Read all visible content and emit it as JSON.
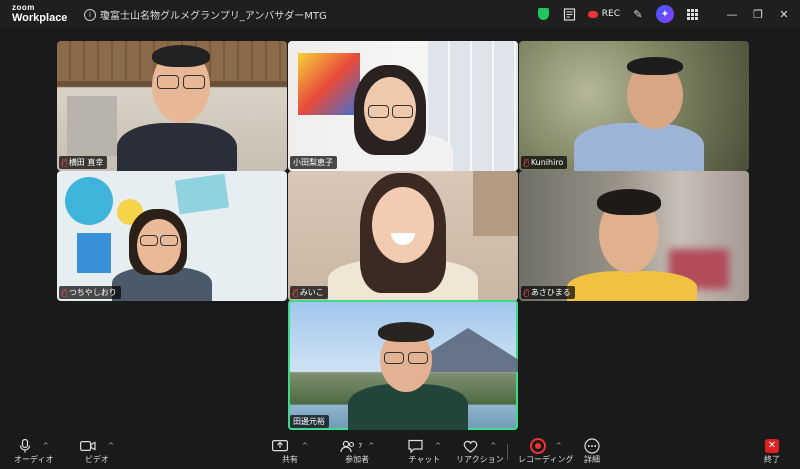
{
  "app": {
    "brand_top": "zoom",
    "brand_bottom": "Workplace"
  },
  "meeting": {
    "title": "瓊富士山名物グルメグランプリ_アンバサダーMTG"
  },
  "titlebar": {
    "rec_label": "REC"
  },
  "participants": [
    {
      "name": "横田 直幸",
      "muted": true
    },
    {
      "name": "小田梨恵子",
      "muted": false
    },
    {
      "name": "Kunihiro",
      "muted": true
    },
    {
      "name": "つちやしおり",
      "muted": true
    },
    {
      "name": "みいこ",
      "muted": true
    },
    {
      "name": "あさひまる",
      "muted": true
    },
    {
      "name": "田邊元裕",
      "muted": false
    }
  ],
  "toolbar": {
    "audio": "オーディオ",
    "video": "ビデオ",
    "share": "共有",
    "participants": "参加者",
    "participants_count": "7",
    "chat": "チャット",
    "reactions": "リアクション",
    "recording": "レコーディング",
    "details": "詳細",
    "end": "終了"
  },
  "icons": {
    "mic": "mic-icon",
    "camera": "camera-icon",
    "share": "share-icon",
    "people": "people-icon",
    "chat": "chat-icon",
    "heart": "heart-icon",
    "record": "record-icon",
    "more": "more-icon",
    "end": "end-icon"
  },
  "colors": {
    "active_speaker": "#3ddc84",
    "record": "#e33333",
    "end": "#e02020",
    "security": "#22c55e"
  }
}
